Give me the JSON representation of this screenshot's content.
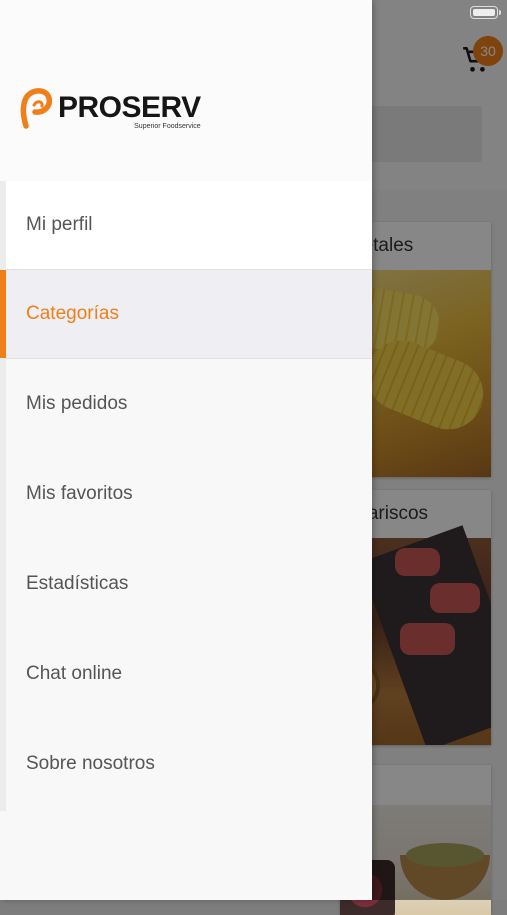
{
  "background": {
    "cart_badge": "30",
    "cards": [
      {
        "title": "getales"
      },
      {
        "title": "Mariscos"
      }
    ]
  },
  "drawer": {
    "logo": {
      "name": "PROSERV",
      "tagline": "Superior Foodservice"
    },
    "menu": [
      {
        "label": "Mi perfil",
        "active": false
      },
      {
        "label": "Categorías",
        "active": true
      },
      {
        "label": "Mis pedidos",
        "active": false
      },
      {
        "label": "Mis favoritos",
        "active": false
      },
      {
        "label": "Estadísticas",
        "active": false
      },
      {
        "label": "Chat online",
        "active": false
      },
      {
        "label": "Sobre nosotros",
        "active": false
      }
    ]
  },
  "colors": {
    "accent": "#f07f1a",
    "drawer_bg": "#f8f8f8",
    "menu_text": "#555555"
  }
}
